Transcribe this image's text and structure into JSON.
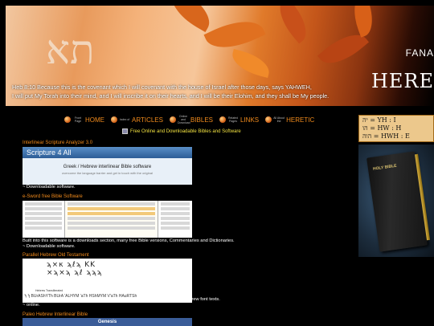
{
  "banner": {
    "hebrew": "תא",
    "verse_line1": "Heb 8:10 Because this is the covenant which I will covenant with the house of Israel after those days, says YAHWEH,",
    "verse_line2": "I will put My Torah into their mind, and I will inscribe it on their hearts, and I will be their Elohim, and they shall be My people.",
    "brand_line1": "FANA",
    "brand_line2": "HERE"
  },
  "nav": {
    "items": [
      {
        "small": "Front Page",
        "label": "HOME"
      },
      {
        "small": "Index of",
        "label": "ARTICLES"
      },
      {
        "small": "Online and Download",
        "label": "BIBLES"
      },
      {
        "small": "Related Pages",
        "label": "LINKS"
      },
      {
        "small": "All About the",
        "label": "HERETIC"
      }
    ]
  },
  "tagline": "Free Online and Downloadable Bibles and Software",
  "entries": [
    {
      "link": "Interlinear Scripture Analyzer 3.0",
      "logo": "Scripture 4 All",
      "heading": "Greek / Hebrew interlinear Bible software",
      "sub": "overcome the language barrier and get in touch with the original",
      "desc": "~ Downloadable software."
    },
    {
      "link": "e-Sword free Bible Software",
      "desc1": "Built into this software is a downloads section, many free Bible versions, Commentaries and Dictionaries.",
      "desc2": "~ Downloadable software."
    },
    {
      "link": "Parallel Hebrew Old Testament",
      "paleo_line1": "ϡ×κ ϡℓϡ ΚK",
      "paleo_line2": "×ϡ×ϡ ϡℓ ϡϡϡ",
      "paleo_caption": "Hebrew Transliterated",
      "paleo_translit": "ϡ ϡ BUrAShYTh BUrA 'ALHYM 'aTh HShMYM V'aTh HAuRTSh",
      "desc1": "The Parallel Hebrew Old Testament contains 14 parallel Bible texts, including 4 Hebrew font texts.",
      "desc2": "~ online."
    },
    {
      "link": "Paleo Hebrew Interlinear Bible",
      "banner": "Genesis"
    }
  ],
  "yhwh": {
    "line1": "יה = YH : I",
    "line2": "הו = HW : H",
    "line3": "הוה = HWH : E"
  },
  "bible_title": "HOLY BIBLE",
  "colors": {
    "link": "#f08a1c",
    "tagline": "#f0e040",
    "bg": "#000000"
  }
}
